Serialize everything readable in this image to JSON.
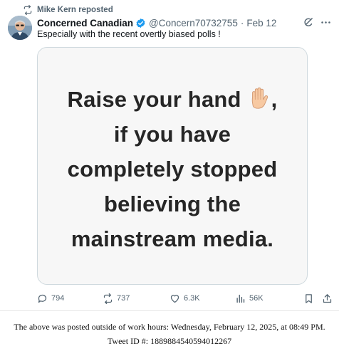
{
  "repost": {
    "text": "Mike Kern reposted",
    "icon": "repost-icon"
  },
  "author": {
    "display_name": "Concerned Canadian",
    "handle": "@Concern70732755",
    "separator": "·",
    "date": "Feb 12",
    "verified_color": "#1d9bf0"
  },
  "tweet": {
    "text": "Especially with the recent overtly biased polls !"
  },
  "media": {
    "lines": [
      "Raise your hand",
      "if you have",
      "completely stopped",
      "believing the",
      "mainstream media."
    ],
    "trailing_comma": ",",
    "emoji": "raised-hand-emoji"
  },
  "actions": {
    "replies": "794",
    "reposts": "737",
    "likes": "6.3K",
    "views": "56K"
  },
  "footer": {
    "line1": "The above was posted outside of work hours: Wednesday, February 12, 2025, at 08:49 PM.",
    "line2": "Tweet ID #: 1889884540594012267"
  }
}
